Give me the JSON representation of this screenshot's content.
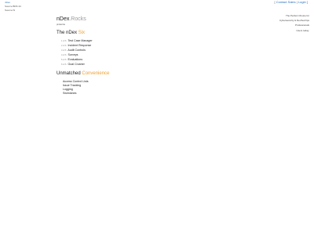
{
  "left": {
    "home_link": "nDex",
    "meta_1": "Source BDS 44",
    "meta_2": "Source IS"
  },
  "top_links": {
    "open_bracket": "[",
    "contact_sales": "Contact Sales",
    "separator": "|",
    "login": "Login",
    "close_bracket": "]"
  },
  "right": {
    "items": [
      "The Perfect Choice for",
      "Cybersecurity & DevSecOps",
      "Professionals",
      "Users today."
    ]
  },
  "brand": {
    "name": "nDex",
    "suffix": ".Rocks",
    "tagline": "pinkwrite"
  },
  "six": {
    "title_prefix": "The nDex",
    "title_accent": "Six",
    "items": [
      {
        "num": "1 of 6",
        "label": "Test Case Manager"
      },
      {
        "num": "2 of 6",
        "label": "Incident Response"
      },
      {
        "num": "3 of 6",
        "label": "Audit Controls"
      },
      {
        "num": "4 of 6",
        "label": "Surveys"
      },
      {
        "num": "5 of 6",
        "label": "Evaluations"
      },
      {
        "num": "6 of 6",
        "label": "Goal Crusher"
      }
    ]
  },
  "convenience": {
    "title_prefix": "Unmatched",
    "title_accent": "Convenience",
    "items": [
      "Access Control Lists",
      "Issue Tracking",
      "Logging",
      "Swimlanes"
    ]
  },
  "colors": {
    "accent": "#f0a030",
    "link": "#2a6fbf"
  }
}
